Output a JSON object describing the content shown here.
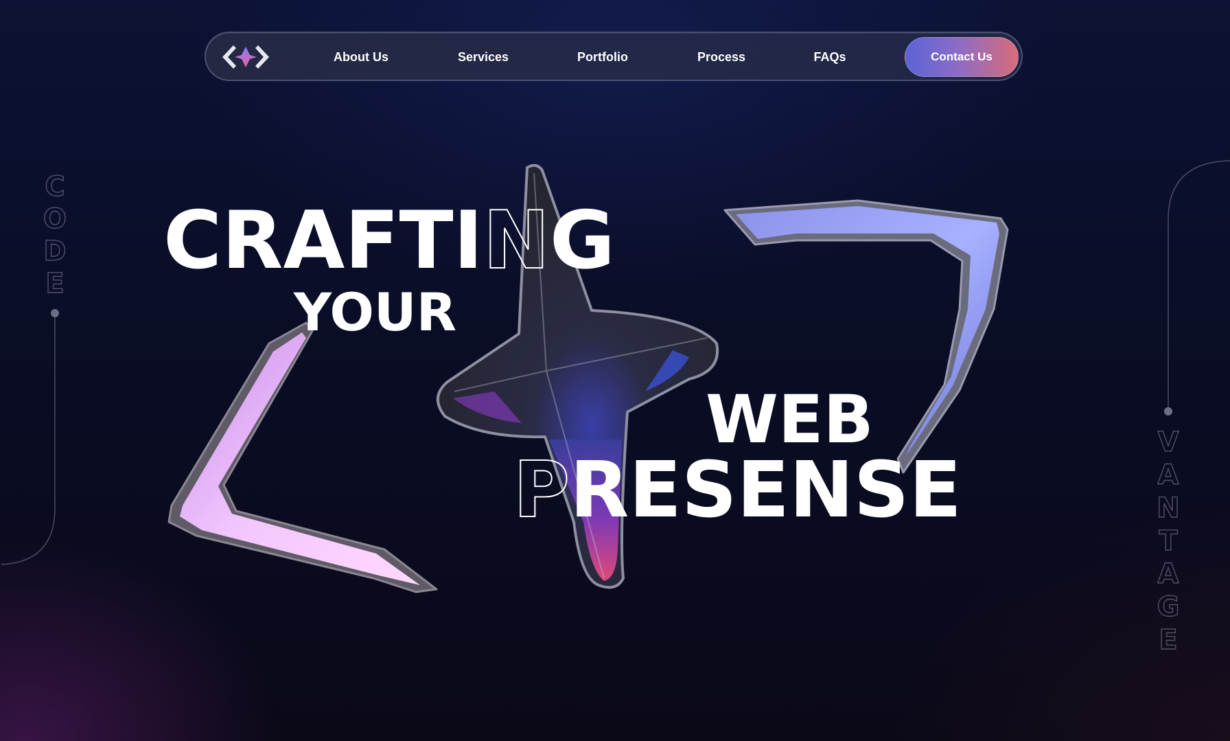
{
  "nav": {
    "logo_icon": "diamond-chevrons-logo-icon",
    "links": [
      "About Us",
      "Services",
      "Portfolio",
      "Process",
      "FAQs"
    ],
    "cta_label": "Contact Us",
    "accent_gradient": [
      "#5b63d6",
      "#d86c78"
    ]
  },
  "side_left": {
    "letters": [
      "C",
      "O",
      "D",
      "E"
    ]
  },
  "side_right": {
    "letters": [
      "V",
      "A",
      "N",
      "T",
      "A",
      "G",
      "E"
    ]
  },
  "hero": {
    "line1_solid": "CRAFTI",
    "line1_outline": "N",
    "line1_end": "G",
    "line2": "YOUR",
    "line3": "WEB",
    "line4_outline": "P",
    "line4_rest": "RESENSE",
    "decor": [
      "left-chevron-3d-icon",
      "star-3d-icon",
      "right-chevron-3d-icon"
    ]
  },
  "colors": {
    "background": "#0a0d26",
    "left_chevron": "#f2c8ff",
    "right_chevron": "#a6b0ff",
    "star": "#2a2b36"
  }
}
